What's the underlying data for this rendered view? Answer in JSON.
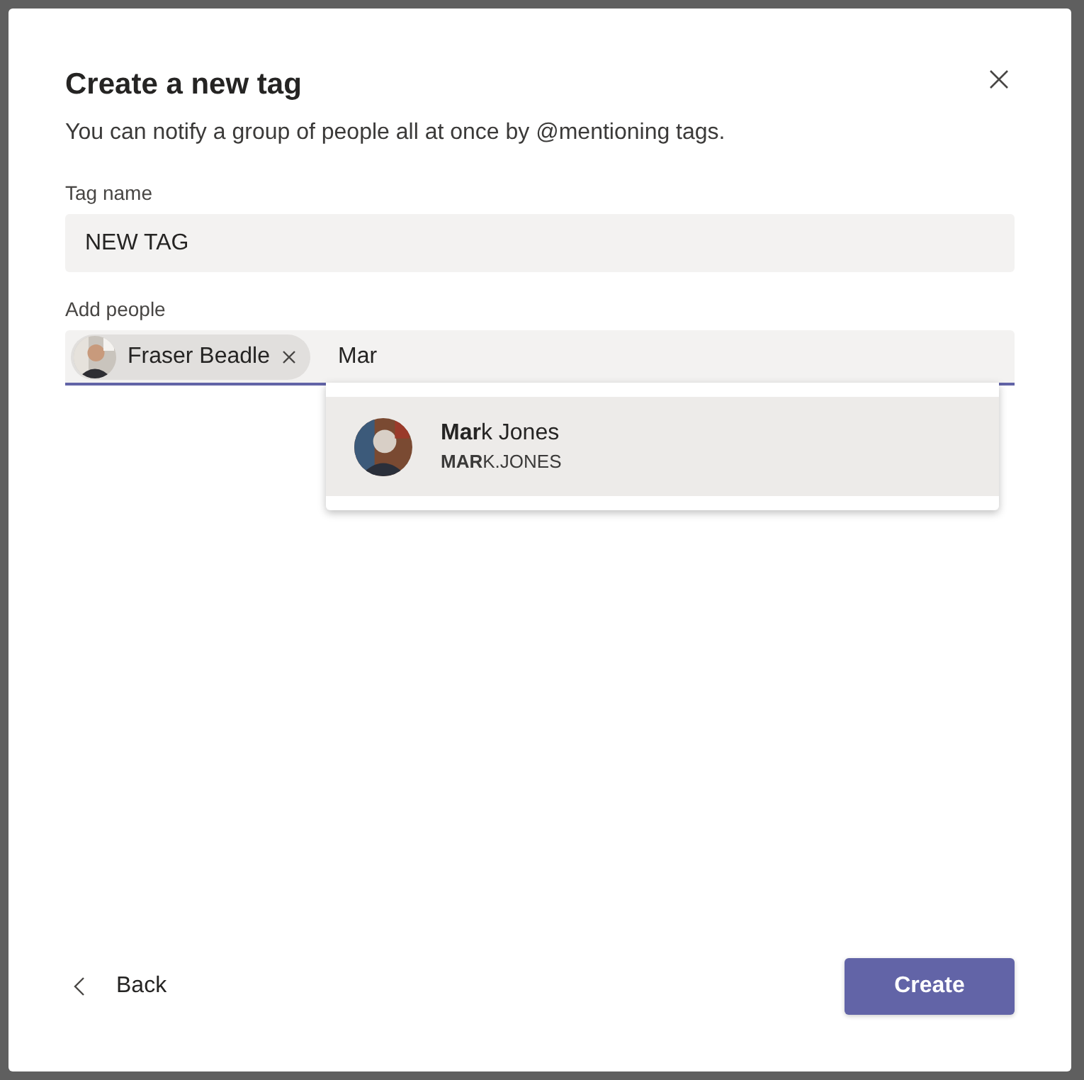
{
  "dialog": {
    "title": "Create a new tag",
    "description": "You can notify a group of people all at once by @mentioning tags.",
    "tag_name": {
      "label": "Tag name",
      "value": "NEW TAG"
    },
    "add_people": {
      "label": "Add people",
      "value": "Mar",
      "chips": [
        {
          "name": "Fraser Beadle"
        }
      ],
      "suggestions": [
        {
          "name": "**Mar**k Jones",
          "handle": "**MAR**K.JONES",
          "selected": true
        }
      ]
    },
    "back": "Back",
    "create": "Create"
  }
}
